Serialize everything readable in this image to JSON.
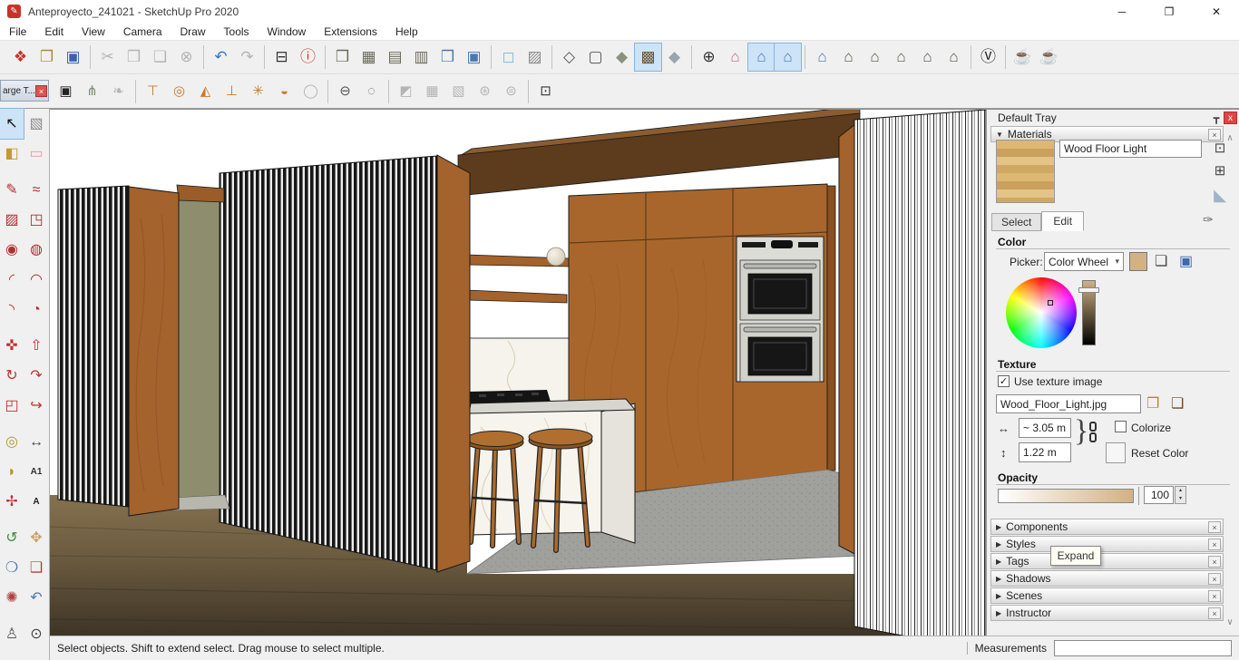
{
  "window": {
    "title": "Anteproyecto_241021 - SketchUp Pro 2020",
    "buttons": {
      "minimize": "─",
      "restore": "❐",
      "close": "✕"
    }
  },
  "menu": {
    "items": [
      "File",
      "Edit",
      "View",
      "Camera",
      "Draw",
      "Tools",
      "Window",
      "Extensions",
      "Help"
    ]
  },
  "toolbars": {
    "row1": [
      {
        "n": "new-file-button",
        "g": "❖",
        "c": "#c8332b"
      },
      {
        "n": "open-file-button",
        "g": "❐",
        "c": "#a98a3e"
      },
      {
        "n": "save-button",
        "g": "▣",
        "c": "#3a62b0"
      },
      {
        "sep": true
      },
      {
        "n": "cut-button",
        "g": "✂",
        "c": "#999",
        "dis": true
      },
      {
        "n": "copy-button",
        "g": "❒",
        "c": "#999",
        "dis": true
      },
      {
        "n": "paste-button",
        "g": "❏",
        "c": "#999",
        "dis": true
      },
      {
        "n": "delete-button",
        "g": "⊗",
        "c": "#999",
        "dis": true
      },
      {
        "sep": true
      },
      {
        "n": "undo-button",
        "g": "↶",
        "c": "#3a76c0"
      },
      {
        "n": "redo-button",
        "g": "↷",
        "c": "#999",
        "dis": true
      },
      {
        "sep": true
      },
      {
        "n": "print-button",
        "g": "⊟",
        "c": "#333"
      },
      {
        "n": "model-info-button",
        "g": "ⓘ",
        "c": "#c8332b"
      },
      {
        "sep": true
      },
      {
        "n": "solid-outer-shell-button",
        "g": "❒",
        "c": "#6a6a58"
      },
      {
        "n": "solid-intersect-button",
        "g": "▦",
        "c": "#6a6a58"
      },
      {
        "n": "solid-union-button",
        "g": "▤",
        "c": "#6a6a58"
      },
      {
        "n": "solid-subtract-button",
        "g": "▥",
        "c": "#6a6a58"
      },
      {
        "n": "solid-trim-button",
        "g": "❒",
        "c": "#4a78b0"
      },
      {
        "n": "solid-split-button",
        "g": "▣",
        "c": "#4a78b0"
      },
      {
        "sep": true
      },
      {
        "n": "xray-mode-button",
        "g": "◻",
        "c": "#8fb8d0"
      },
      {
        "n": "back-edges-button",
        "g": "▨",
        "c": "#8a8a8a"
      },
      {
        "sep": true
      },
      {
        "n": "wireframe-button",
        "g": "◇",
        "c": "#555"
      },
      {
        "n": "hidden-line-button",
        "g": "▢",
        "c": "#555"
      },
      {
        "n": "shaded-button",
        "g": "◆",
        "c": "#8a927e"
      },
      {
        "n": "shaded-textures-button",
        "g": "▩",
        "c": "#6a5434",
        "act": true
      },
      {
        "n": "monochrome-button",
        "g": "◆",
        "c": "#9aa4ae"
      },
      {
        "sep": true
      },
      {
        "n": "section-plane-button",
        "g": "⊕",
        "c": "#333"
      },
      {
        "n": "display-section-planes-button",
        "g": "⌂",
        "c": "#c06888"
      },
      {
        "n": "display-section-cuts-button",
        "g": "⌂",
        "c": "#4a78b0",
        "act": true
      },
      {
        "n": "display-section-fill-button",
        "g": "⌂",
        "c": "#4a78b0",
        "act": true
      },
      {
        "sep": true
      },
      {
        "n": "view-iso-button",
        "g": "⌂",
        "c": "#4a78b0"
      },
      {
        "n": "view-top-button",
        "g": "⌂",
        "c": "#55554a"
      },
      {
        "n": "view-front-button",
        "g": "⌂",
        "c": "#55554a"
      },
      {
        "n": "view-right-button",
        "g": "⌂",
        "c": "#55554a"
      },
      {
        "n": "view-back-button",
        "g": "⌂",
        "c": "#55554a"
      },
      {
        "n": "view-left-button",
        "g": "⌂",
        "c": "#55554a"
      },
      {
        "sep": true
      },
      {
        "n": "vray-logo-button",
        "g": "Ⓥ",
        "c": "#222"
      },
      {
        "sep": true
      },
      {
        "n": "vray-render-button",
        "g": "☕",
        "c": "#333"
      },
      {
        "n": "vray-render-cloud-button",
        "g": "☕",
        "c": "#333"
      }
    ],
    "row2": [
      {
        "n": "component-box-button",
        "g": "▣",
        "c": "#222"
      },
      {
        "n": "fur-button",
        "g": "⋔",
        "c": "#7a8a6a"
      },
      {
        "n": "leaf-button",
        "g": "❧",
        "c": "#999",
        "dis": true
      },
      {
        "sep": true
      },
      {
        "n": "vray-rectangle-light-button",
        "g": "⊤",
        "c": "#c87a2e"
      },
      {
        "n": "vray-sphere-light-button",
        "g": "◎",
        "c": "#c87a2e"
      },
      {
        "n": "vray-spot-light-button",
        "g": "◭",
        "c": "#c87a2e"
      },
      {
        "n": "vray-ies-light-button",
        "g": "⊥",
        "c": "#c87a2e"
      },
      {
        "n": "vray-omni-light-button",
        "g": "✳",
        "c": "#c87a2e"
      },
      {
        "n": "vray-dome-light-button",
        "g": "◒",
        "c": "#c87a2e"
      },
      {
        "n": "vray-mesh-light-button",
        "g": "◯",
        "c": "#999",
        "dis": true
      },
      {
        "sep": true
      },
      {
        "n": "vray-infinite-plane-button",
        "g": "⊖",
        "c": "#555"
      },
      {
        "n": "vray-proxy-button",
        "g": "◌",
        "c": "#555"
      },
      {
        "sep": true
      },
      {
        "n": "vray-clipper-button",
        "g": "◩",
        "c": "#999",
        "dis": true
      },
      {
        "n": "uvw-box-button",
        "g": "▦",
        "c": "#999",
        "dis": true
      },
      {
        "n": "uvw-triplanar-button",
        "g": "▧",
        "c": "#999",
        "dis": true
      },
      {
        "n": "uvw-checker-a-button",
        "g": "⊛",
        "c": "#999",
        "dis": true
      },
      {
        "n": "uvw-checker-b-button",
        "g": "⊜",
        "c": "#999",
        "dis": true
      },
      {
        "sep": true
      },
      {
        "n": "vray-interact-button",
        "g": "⊡",
        "c": "#333"
      }
    ],
    "large_tool_set_title": "arge T...",
    "large_tool_set_close": "×"
  },
  "palette": {
    "items": [
      {
        "n": "select-tool",
        "g": "↖",
        "c": "#111",
        "act": true
      },
      {
        "n": "make-component-tool",
        "g": "▧",
        "c": "#8a8a8a"
      },
      {
        "n": "paint-bucket-tool",
        "g": "◧",
        "c": "#c59a30"
      },
      {
        "n": "eraser-tool",
        "g": "▭",
        "c": "#e59aa6"
      },
      {
        "gap": true
      },
      {
        "n": "line-tool",
        "g": "✎",
        "c": "#b03030"
      },
      {
        "n": "freehand-tool",
        "g": "≈",
        "c": "#b03030"
      },
      {
        "n": "rectangle-tool",
        "g": "▨",
        "c": "#b03030"
      },
      {
        "n": "rotated-rectangle-tool",
        "g": "◳",
        "c": "#b03030"
      },
      {
        "n": "circle-tool",
        "g": "◉",
        "c": "#b03030"
      },
      {
        "n": "polygon-tool",
        "g": "◍",
        "c": "#b03030"
      },
      {
        "n": "arc-tool",
        "g": "◜",
        "c": "#b03030"
      },
      {
        "n": "two-point-arc-tool",
        "g": "◠",
        "c": "#b03030"
      },
      {
        "n": "three-point-arc-tool",
        "g": "◝",
        "c": "#b03030"
      },
      {
        "n": "pie-tool",
        "g": "◔",
        "c": "#b03030"
      },
      {
        "gap": true
      },
      {
        "n": "move-tool",
        "g": "✜",
        "c": "#c03030"
      },
      {
        "n": "push-pull-tool",
        "g": "⇧",
        "c": "#c03030"
      },
      {
        "n": "rotate-tool",
        "g": "↻",
        "c": "#c03030"
      },
      {
        "n": "follow-me-tool",
        "g": "↷",
        "c": "#c03030"
      },
      {
        "n": "scale-tool",
        "g": "◰",
        "c": "#c03030"
      },
      {
        "n": "offset-tool",
        "g": "↪",
        "c": "#c03030"
      },
      {
        "gap": true
      },
      {
        "n": "tape-measure-tool",
        "g": "◎",
        "c": "#b09a2e"
      },
      {
        "n": "dimension-tool",
        "g": "↔",
        "c": "#444"
      },
      {
        "n": "protractor-tool",
        "g": "◗",
        "c": "#b09a2e"
      },
      {
        "n": "text-tool",
        "g": "A1",
        "c": "#333",
        "txt": true
      },
      {
        "n": "axes-tool",
        "g": "✢",
        "c": "#c03030"
      },
      {
        "n": "3d-text-tool",
        "g": "A",
        "c": "#222",
        "txt": true
      },
      {
        "gap": true
      },
      {
        "n": "orbit-tool",
        "g": "↺",
        "c": "#3f8f3f"
      },
      {
        "n": "pan-tool",
        "g": "✥",
        "c": "#caa06a"
      },
      {
        "n": "zoom-tool",
        "g": "❍",
        "c": "#4a7ab5"
      },
      {
        "n": "zoom-window-tool",
        "g": "❑",
        "c": "#b04040"
      },
      {
        "n": "zoom-extents-tool",
        "g": "✺",
        "c": "#b04040"
      },
      {
        "n": "previous-view-tool",
        "g": "↶",
        "c": "#4a7ab5"
      },
      {
        "gap": true
      },
      {
        "n": "position-camera-tool",
        "g": "♙",
        "c": "#555"
      },
      {
        "n": "look-around-tool",
        "g": "⊙",
        "c": "#444"
      }
    ]
  },
  "viewport": {
    "scene": "kitchen-interior-3d-model",
    "colors": {
      "wood_panel": "#a4622c",
      "dark_beam": "#5d3b1d",
      "slat_dark": "#1c1c1c",
      "slat_light": "#f7f7f7",
      "olive_wall": "#8e8e6e",
      "floor_wood": "#6e5d41",
      "floor_concrete": "#9f9f9c",
      "marble": "#f6f3ec",
      "stainless": "#dcdcd6",
      "stool_wood": "#b06f30",
      "oven_glass": "#161616"
    },
    "elements": [
      "left-slat-wall",
      "door-frame",
      "door-opening",
      "center-slat-wall",
      "ceiling-beam",
      "wall-shelves",
      "sphere-lamp",
      "marble-backsplash",
      "cooktop",
      "tall-cabinets",
      "double-wall-oven",
      "kitchen-island",
      "bar-stool-left",
      "bar-stool-right",
      "concrete-floor",
      "wood-floor",
      "right-slat-wall"
    ]
  },
  "tray": {
    "title": "Default Tray",
    "pin_icon": "┳",
    "close_icon": "x",
    "scroll_up": "∧",
    "scroll_down": "∨",
    "materials": {
      "label": "Materials",
      "collapse_arrow": "▼",
      "close": "×",
      "name_value": "Wood Floor Light",
      "tabs": {
        "select": "Select",
        "edit": "Edit"
      },
      "color_label": "Color",
      "picker_label": "Picker:",
      "picker_value": "Color Wheel",
      "picker_arrow": "▾",
      "swatch_color": "#d2b183",
      "texture_label": "Texture",
      "use_texture_label": "Use texture image",
      "use_texture_checked": "✓",
      "filename": "Wood_Floor_Light.jpg",
      "width_value": "~ 3.05 m",
      "height_value": "1.22 m",
      "brace": "}",
      "colorize_label": "Colorize",
      "reset_label": "Reset Color",
      "opacity_label": "Opacity",
      "opacity_value": "100",
      "h_arrow": "↔",
      "v_arrow": "↕"
    },
    "sections": [
      "Components",
      "Styles",
      "Tags",
      "Shadows",
      "Scenes",
      "Instructor"
    ],
    "section_arrow": "▶",
    "section_close": "×",
    "tooltip": "Expand"
  },
  "status": {
    "message": "Select objects. Shift to extend select. Drag mouse to select multiple.",
    "measurements_label": "Measurements",
    "measurements_value": ""
  }
}
